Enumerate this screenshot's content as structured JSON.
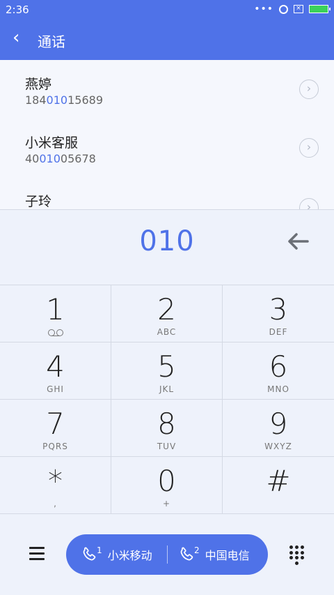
{
  "status_bar": {
    "time": "2:36",
    "dots": "•••"
  },
  "app_bar": {
    "title": "通话"
  },
  "contacts": [
    {
      "name": "燕婷",
      "number_pre": "184",
      "number_match": "010",
      "number_post": "15689"
    },
    {
      "name": "小米客服",
      "number_pre": "40",
      "number_match": "010",
      "number_post": "05678"
    },
    {
      "name": "子玲",
      "number_pre": "",
      "number_match": "",
      "number_post": ""
    }
  ],
  "dial_input": {
    "value": "010"
  },
  "keypad": [
    {
      "digit": "1",
      "letters": ""
    },
    {
      "digit": "2",
      "letters": "ABC"
    },
    {
      "digit": "3",
      "letters": "DEF"
    },
    {
      "digit": "4",
      "letters": "GHI"
    },
    {
      "digit": "5",
      "letters": "JKL"
    },
    {
      "digit": "6",
      "letters": "MNO"
    },
    {
      "digit": "7",
      "letters": "PQRS"
    },
    {
      "digit": "8",
      "letters": "TUV"
    },
    {
      "digit": "9",
      "letters": "WXYZ"
    },
    {
      "digit": "*",
      "letters": ","
    },
    {
      "digit": "0",
      "letters": "+"
    },
    {
      "digit": "#",
      "letters": ""
    }
  ],
  "call_buttons": [
    {
      "sim": "1",
      "carrier": "小米移动"
    },
    {
      "sim": "2",
      "carrier": "中国电信"
    }
  ],
  "colors": {
    "accent": "#4f72e8",
    "background": "#eef2fb"
  },
  "icons": [
    "back-arrow-icon",
    "chevron-right-icon",
    "backspace-icon",
    "voicemail-icon",
    "menu-icon",
    "phone-icon",
    "dialpad-icon"
  ]
}
